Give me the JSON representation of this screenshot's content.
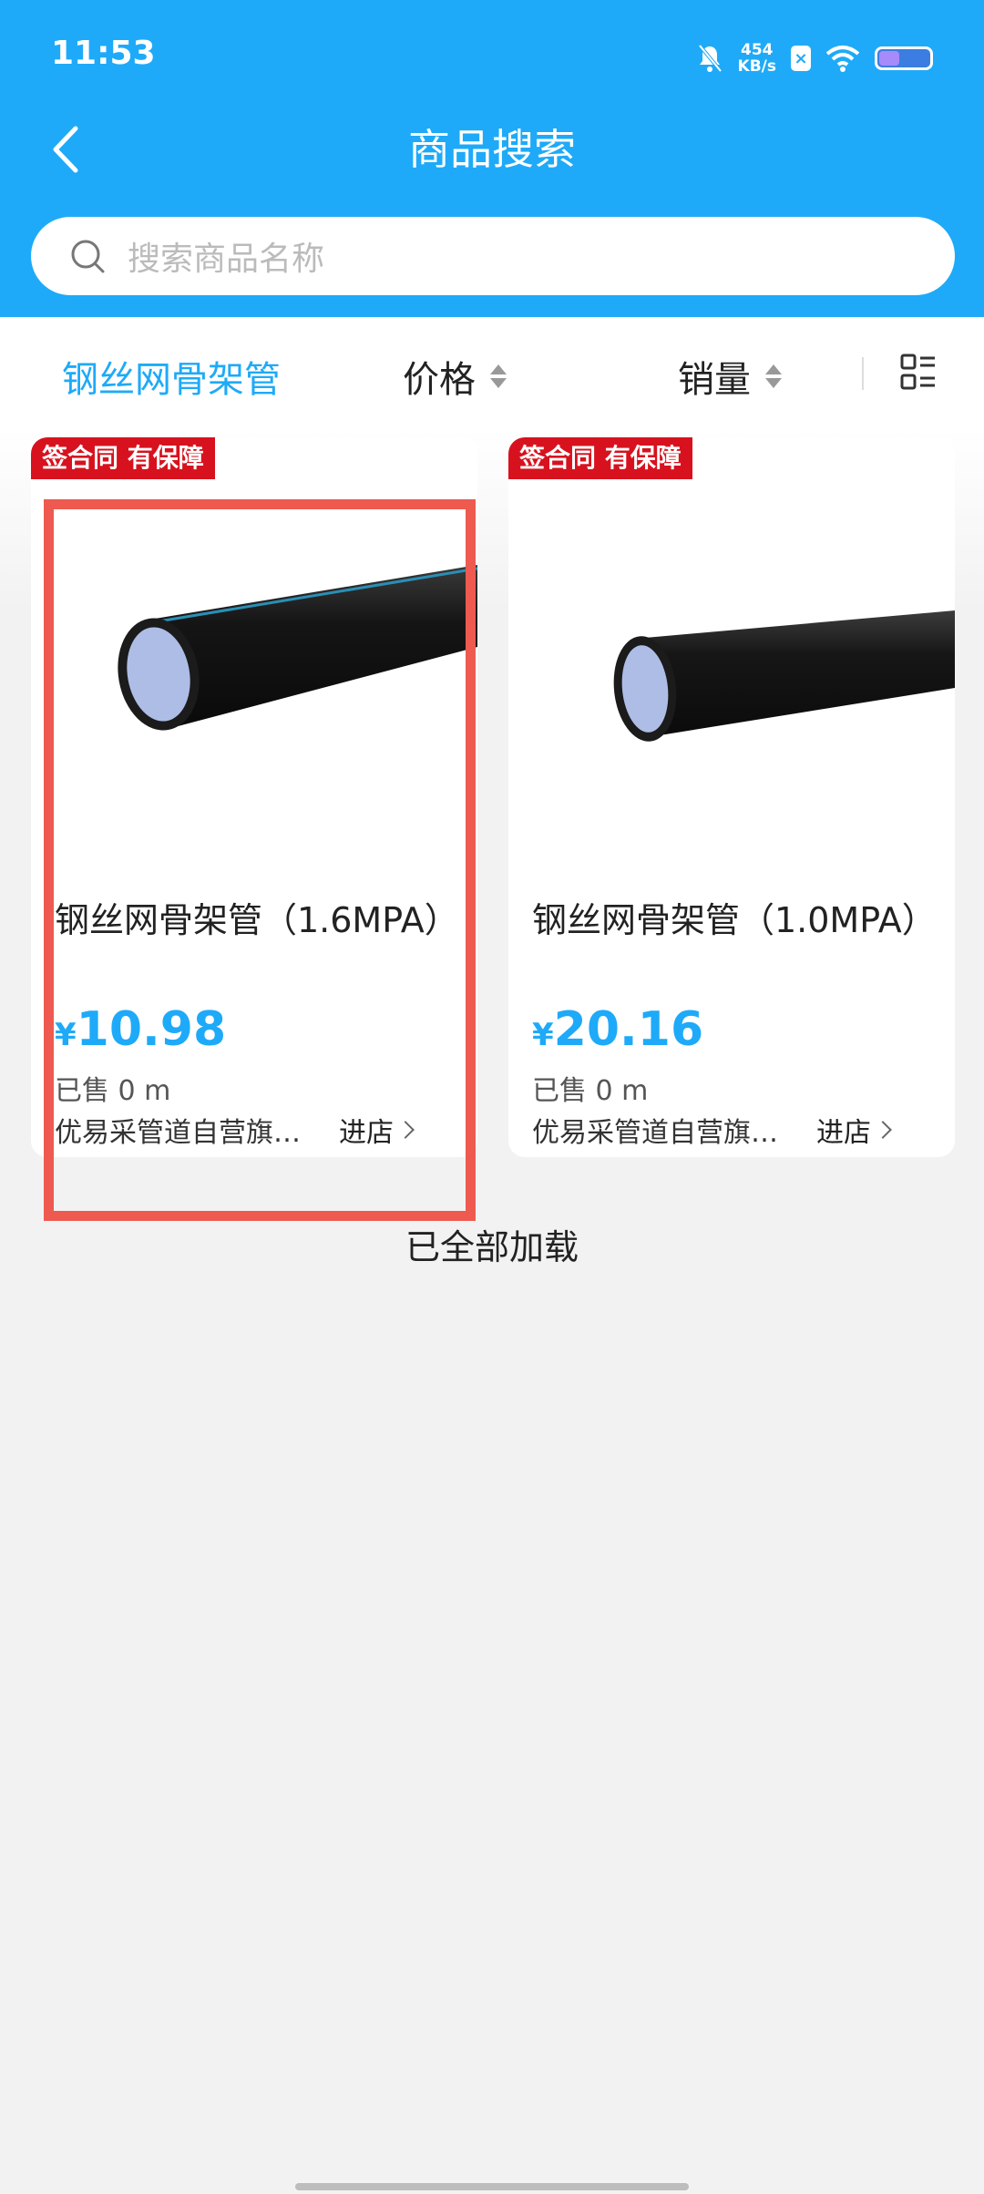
{
  "status": {
    "time": "11:53",
    "net_speed_top": "454",
    "net_speed_bottom": "KB/s",
    "x_badge": "×"
  },
  "header": {
    "title": "商品搜索"
  },
  "search": {
    "placeholder": "搜索商品名称"
  },
  "tabs": {
    "keyword": "钢丝网骨架管",
    "price": "价格",
    "sales": "销量"
  },
  "products": [
    {
      "badge": "签合同 有保障",
      "name": "钢丝网骨架管（1.6MPA）",
      "currency": "¥",
      "price": "10.98",
      "sold": "已售 0 m",
      "shop": "优易采管道自营旗…",
      "enter": "进店"
    },
    {
      "badge": "签合同 有保障",
      "name": "钢丝网骨架管（1.0MPA）",
      "currency": "¥",
      "price": "20.16",
      "sold": "已售 0 m",
      "shop": "优易采管道自营旗…",
      "enter": "进店"
    }
  ],
  "footer": {
    "load_all": "已全部加载"
  },
  "colors": {
    "accent": "#1eaaf8",
    "badge": "#d7121e",
    "highlight": "#ee5a4f"
  }
}
